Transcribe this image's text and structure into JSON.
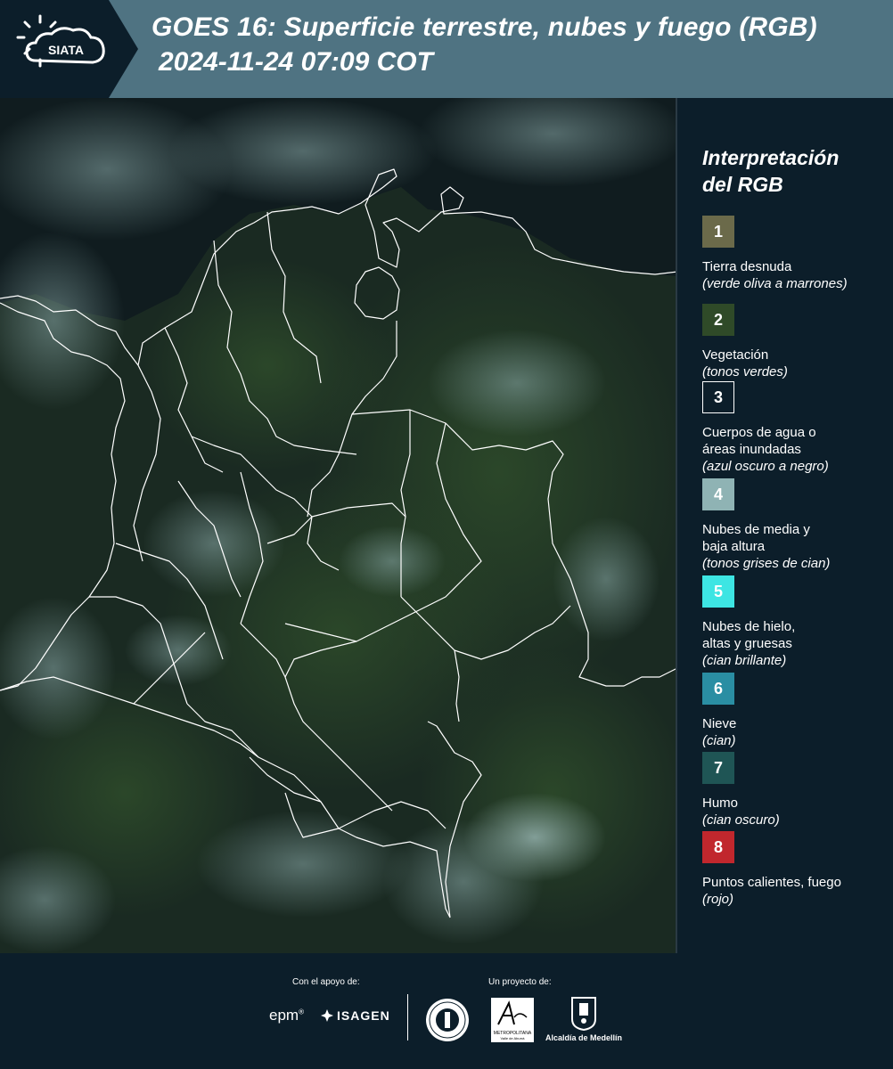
{
  "header": {
    "logo_text": "SIATA",
    "title_line1": "GOES 16: Superficie terrestre, nubes y fuego (RGB)",
    "title_line2": "2024-11-24 07:09 COT"
  },
  "legend": {
    "title": "Interpretación del RGB",
    "items": [
      {
        "number": "1",
        "label": "Tierra desnuda",
        "sub": "(verde oliva a marrones)",
        "color": "#6b6a4a",
        "text_color": "#ffffff"
      },
      {
        "number": "2",
        "label": "Vegetación",
        "sub": "(tonos verdes)",
        "color": "#2f4a28",
        "text_color": "#ffffff"
      },
      {
        "number": "3",
        "label": "Cuerpos de agua o áreas inundadas",
        "sub": "(azul oscuro a negro)",
        "color": "#0c1e2a",
        "text_color": "#ffffff",
        "border": "#ffffff"
      },
      {
        "number": "4",
        "label": "Nubes de media y baja altura",
        "sub": "(tonos grises de cian)",
        "color": "#8fb3b4",
        "text_color": "#ffffff"
      },
      {
        "number": "5",
        "label": "Nubes de hielo, altas y gruesas",
        "sub": "(cian brillante)",
        "color": "#3de5e3",
        "text_color": "#ffffff"
      },
      {
        "number": "6",
        "label": "Nieve",
        "sub": "(cian)",
        "color": "#2a8ea3",
        "text_color": "#ffffff"
      },
      {
        "number": "7",
        "label": "Humo",
        "sub": "(cian oscuro)",
        "color": "#1f5555",
        "text_color": "#ffffff"
      },
      {
        "number": "8",
        "label": "Puntos calientes, fuego",
        "sub": "(rojo)",
        "color": "#c1272d",
        "text_color": "#ffffff"
      }
    ]
  },
  "footer": {
    "support_label": "Con el apoyo de:",
    "project_label": "Un proyecto de:",
    "epm": "epm",
    "isagen": "ISAGEN",
    "area_line1": "METROPOLITANA",
    "area_line2": "Valle de Aburrá",
    "alcaldia": "Alcaldía de Medellín"
  }
}
